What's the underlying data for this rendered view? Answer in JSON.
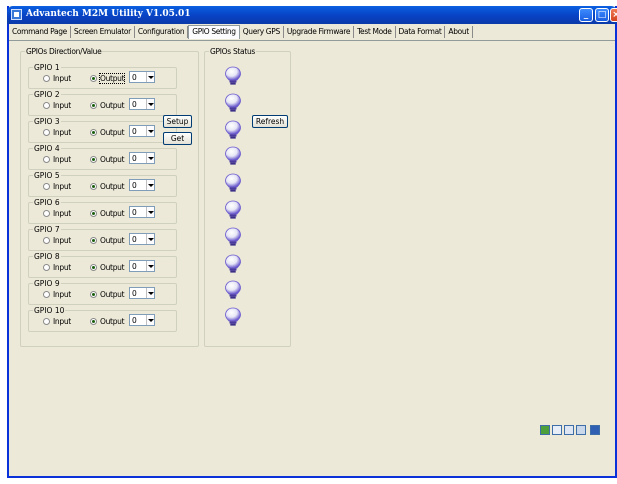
{
  "window": {
    "title": "Advantech M2M Utility V1.05.01"
  },
  "tabs": [
    {
      "label": "Command Page",
      "active": false
    },
    {
      "label": "Screen Emulator",
      "active": false
    },
    {
      "label": "Configuration",
      "active": false
    },
    {
      "label": "GPIO Setting",
      "active": true
    },
    {
      "label": "Query GPS",
      "active": false
    },
    {
      "label": "Upgrade Firmware",
      "active": false
    },
    {
      "label": "Test Mode",
      "active": false
    },
    {
      "label": "Data Format",
      "active": false
    },
    {
      "label": "About",
      "active": false
    }
  ],
  "direction_group": {
    "title": "GPIOs Direction/Value",
    "input_label": "Input",
    "output_label": "Output",
    "gpios": [
      {
        "label": "GPIO 1",
        "mode": "Output",
        "value": "0"
      },
      {
        "label": "GPIO 2",
        "mode": "Output",
        "value": "0"
      },
      {
        "label": "GPIO 3",
        "mode": "Output",
        "value": "0"
      },
      {
        "label": "GPIO 4",
        "mode": "Output",
        "value": "0"
      },
      {
        "label": "GPIO 5",
        "mode": "Output",
        "value": "0"
      },
      {
        "label": "GPIO 6",
        "mode": "Output",
        "value": "0"
      },
      {
        "label": "GPIO 7",
        "mode": "Output",
        "value": "0"
      },
      {
        "label": "GPIO 8",
        "mode": "Output",
        "value": "0"
      },
      {
        "label": "GPIO 9",
        "mode": "Output",
        "value": "0"
      },
      {
        "label": "GPIO 10",
        "mode": "Output",
        "value": "0"
      }
    ]
  },
  "buttons": {
    "setup": "Setup",
    "get": "Get",
    "refresh": "Refresh"
  },
  "status_group": {
    "title": "GPIOs Status",
    "bulb_icon": "lightbulb-icon",
    "bulb_color": "#6a5acd"
  }
}
